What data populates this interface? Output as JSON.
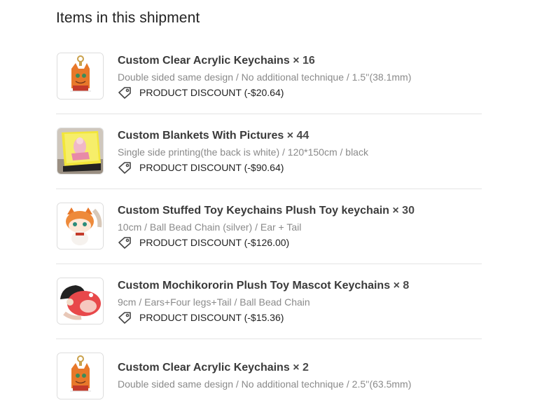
{
  "heading": "Items in this shipment",
  "items": [
    {
      "name": "Custom Clear Acrylic Keychains",
      "quantity": "× 16",
      "variant": "Double sided same design / No additional technique / 1.5''(38.1mm)",
      "discount": "PRODUCT DISCOUNT (-$20.64)",
      "thumbnail_icon": "acrylic-keychain-image"
    },
    {
      "name": "Custom Blankets With Pictures",
      "quantity": "× 44",
      "variant": "Single side printing(the back is white) / 120*150cm / black",
      "discount": "PRODUCT DISCOUNT (-$90.64)",
      "thumbnail_icon": "blanket-image"
    },
    {
      "name": "Custom Stuffed Toy Keychains Plush Toy keychain",
      "quantity": "× 30",
      "variant": "10cm / Ball Bead Chain  (silver)  / Ear + Tail",
      "discount": "PRODUCT DISCOUNT (-$126.00)",
      "thumbnail_icon": "plush-keychain-image"
    },
    {
      "name": "Custom Mochikororin Plush Toy Mascot Keychains",
      "quantity": "× 8",
      "variant": "9cm / Ears+Four legs+Tail / Ball Bead Chain",
      "discount": "PRODUCT DISCOUNT (-$15.36)",
      "thumbnail_icon": "mochi-plush-image"
    },
    {
      "name": "Custom Clear Acrylic Keychains",
      "quantity": "× 2",
      "variant": "Double sided same design / No additional technique / 2.5''(63.5mm)",
      "discount": "",
      "thumbnail_icon": "acrylic-keychain-image"
    }
  ],
  "colors": {
    "title": "#3a3a3a",
    "variant": "#8a8a8a",
    "divider": "#e4e4e4",
    "accent_orange": "#e8782a"
  }
}
